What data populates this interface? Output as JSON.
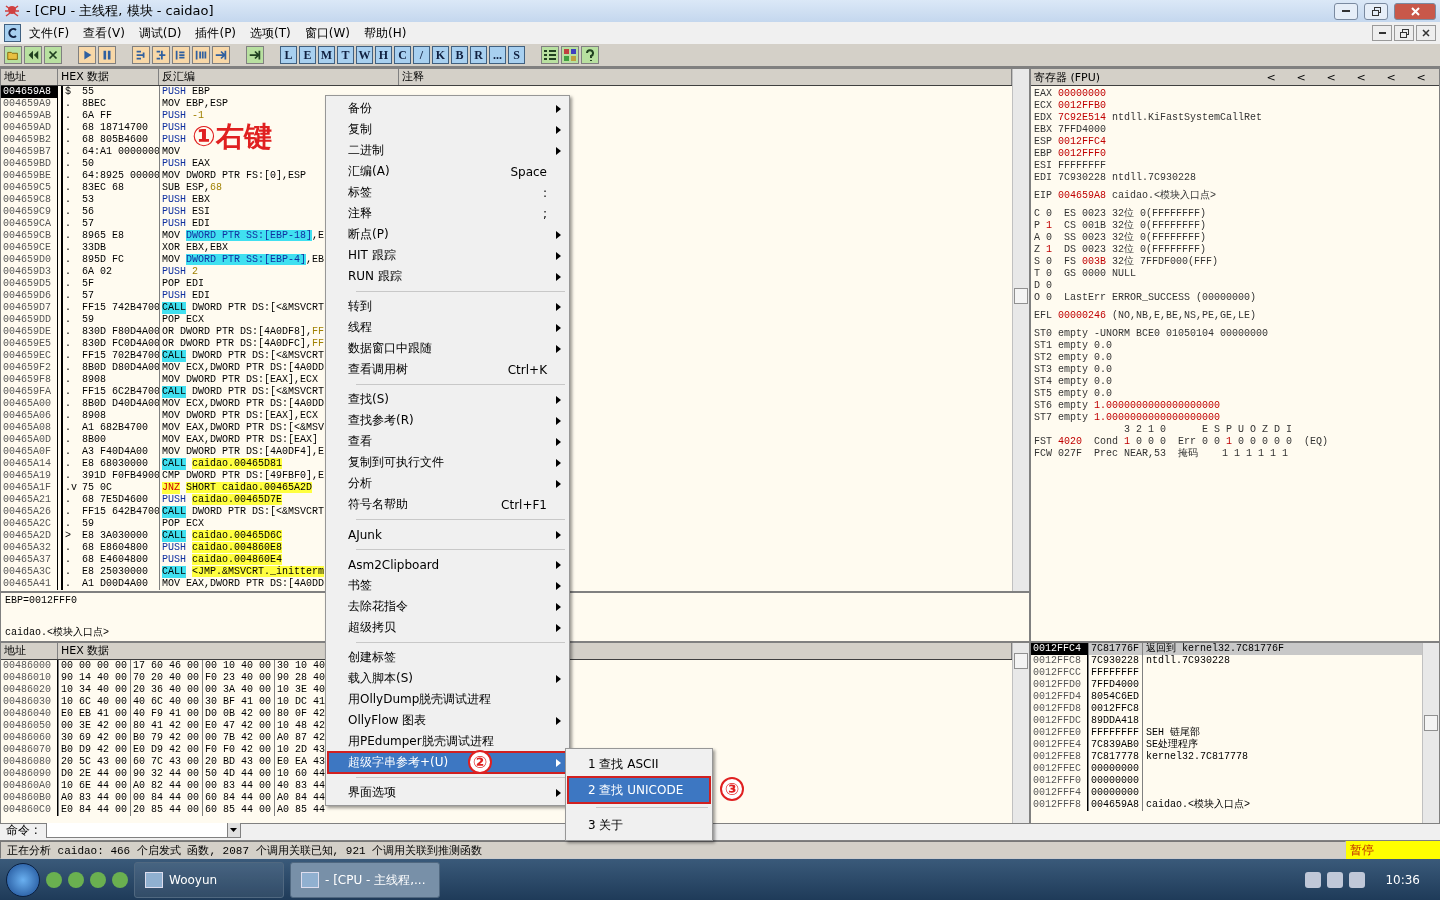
{
  "window": {
    "title": "- [CPU - 主线程, 模块 - caidao]"
  },
  "menu_bar": [
    "文件(F)",
    "查看(V)",
    "调试(D)",
    "插件(P)",
    "选项(T)",
    "窗口(W)",
    "帮助(H)"
  ],
  "toolbar": {
    "letters": [
      "L",
      "E",
      "M",
      "T",
      "W",
      "H",
      "C",
      "/",
      "K",
      "B",
      "R",
      "...",
      "S"
    ]
  },
  "disassembly": {
    "columns": [
      "地址",
      "HEX 数据",
      "反汇编",
      "注释"
    ],
    "rows": [
      {
        "address": "004659A8",
        "mark": "$",
        "hex": "55",
        "op": "PUSH",
        "kind": "push",
        "args": [
          {
            "text": "EBP",
            "kind": "plain"
          }
        ],
        "selected": true
      },
      {
        "address": "004659A9",
        "mark": ".",
        "hex": "8BEC",
        "op": "MOV",
        "kind": "plain",
        "args": [
          {
            "text": "EBP,ESP",
            "kind": "plain"
          }
        ],
        "selected": false
      },
      {
        "address": "004659AB",
        "mark": ".",
        "hex": "6A FF",
        "op": "PUSH",
        "kind": "push",
        "args": [
          {
            "text": "-1",
            "kind": "const"
          }
        ],
        "selected": false
      },
      {
        "address": "004659AD",
        "mark": ".",
        "hex": "68 18714700",
        "op": "PUSH",
        "kind": "push",
        "args": [],
        "selected": false
      },
      {
        "address": "004659B2",
        "mark": ".",
        "hex": "68 805B4600",
        "op": "PUSH",
        "kind": "push",
        "args": [],
        "selected": false
      },
      {
        "address": "004659B7",
        "mark": ".",
        "hex": "64:A1 0000000",
        "op": "MOV",
        "kind": "plain",
        "args": [],
        "selected": false
      },
      {
        "address": "004659BD",
        "mark": ".",
        "hex": "50",
        "op": "PUSH",
        "kind": "push",
        "args": [
          {
            "text": "EAX",
            "kind": "plain"
          }
        ],
        "selected": false
      },
      {
        "address": "004659BE",
        "mark": ".",
        "hex": "64:8925 00000",
        "op": "MOV",
        "kind": "plain",
        "args": [
          {
            "text": "DWORD PTR FS:[0],ESP",
            "kind": "plain"
          }
        ],
        "selected": false
      },
      {
        "address": "004659C5",
        "mark": ".",
        "hex": "83EC 68",
        "op": "SUB",
        "kind": "plain",
        "args": [
          {
            "text": "ESP,",
            "kind": "plain"
          },
          {
            "text": "68",
            "kind": "const"
          }
        ],
        "selected": false
      },
      {
        "address": "004659C8",
        "mark": ".",
        "hex": "53",
        "op": "PUSH",
        "kind": "push",
        "args": [
          {
            "text": "EBX",
            "kind": "plain"
          }
        ],
        "selected": false
      },
      {
        "address": "004659C9",
        "mark": ".",
        "hex": "56",
        "op": "PUSH",
        "kind": "push",
        "args": [
          {
            "text": "ESI",
            "kind": "plain"
          }
        ],
        "selected": false
      },
      {
        "address": "004659CA",
        "mark": ".",
        "hex": "57",
        "op": "PUSH",
        "kind": "push",
        "args": [
          {
            "text": "EDI",
            "kind": "plain"
          }
        ],
        "selected": false
      },
      {
        "address": "004659CB",
        "mark": ".",
        "hex": "8965 E8",
        "op": "MOV",
        "kind": "plain",
        "args": [
          {
            "text": "DWORD PTR SS:[EBP-18]",
            "kind": "stack"
          },
          {
            "text": ",E",
            "kind": "plain"
          }
        ],
        "selected": false
      },
      {
        "address": "004659CE",
        "mark": ".",
        "hex": "33DB",
        "op": "XOR",
        "kind": "plain",
        "args": [
          {
            "text": "EBX,EBX",
            "kind": "plain"
          }
        ],
        "selected": false
      },
      {
        "address": "004659D0",
        "mark": ".",
        "hex": "895D FC",
        "op": "MOV",
        "kind": "plain",
        "args": [
          {
            "text": "DWORD PTR SS:[EBP-4]",
            "kind": "stack"
          },
          {
            "text": ",EB",
            "kind": "plain"
          }
        ],
        "selected": false
      },
      {
        "address": "004659D3",
        "mark": ".",
        "hex": "6A 02",
        "op": "PUSH",
        "kind": "push",
        "args": [
          {
            "text": "2",
            "kind": "const"
          }
        ],
        "selected": false
      },
      {
        "address": "004659D5",
        "mark": ".",
        "hex": "5F",
        "op": "POP",
        "kind": "plain",
        "args": [
          {
            "text": "EDI",
            "kind": "plain"
          }
        ],
        "selected": false
      },
      {
        "address": "004659D6",
        "mark": ".",
        "hex": "57",
        "op": "PUSH",
        "kind": "push",
        "args": [
          {
            "text": "EDI",
            "kind": "plain"
          }
        ],
        "selected": false
      },
      {
        "address": "004659D7",
        "mark": ".",
        "hex": "FF15 742B4700",
        "op": "CALL",
        "kind": "call",
        "args": [
          {
            "text": "DWORD PTR DS:[<&MSVCRT",
            "kind": "plain"
          }
        ],
        "selected": false
      },
      {
        "address": "004659DD",
        "mark": ".",
        "hex": "59",
        "op": "POP",
        "kind": "plain",
        "args": [
          {
            "text": "ECX",
            "kind": "plain"
          }
        ],
        "selected": false
      },
      {
        "address": "004659DE",
        "mark": ".",
        "hex": "830D F80D4A00",
        "op": "OR",
        "kind": "plain",
        "args": [
          {
            "text": "DWORD PTR DS:[4A0DF8],",
            "kind": "plain"
          },
          {
            "text": "FF",
            "kind": "const"
          }
        ],
        "selected": false
      },
      {
        "address": "004659E5",
        "mark": ".",
        "hex": "830D FC0D4A00",
        "op": "OR",
        "kind": "plain",
        "args": [
          {
            "text": "DWORD PTR DS:[4A0DFC],",
            "kind": "plain"
          },
          {
            "text": "FF",
            "kind": "const"
          }
        ],
        "selected": false
      },
      {
        "address": "004659EC",
        "mark": ".",
        "hex": "FF15 702B4700",
        "op": "CALL",
        "kind": "call",
        "args": [
          {
            "text": "DWORD PTR DS:[<&MSVCRT",
            "kind": "plain"
          }
        ],
        "selected": false
      },
      {
        "address": "004659F2",
        "mark": ".",
        "hex": "8B0D D80D4A00",
        "op": "MOV",
        "kind": "plain",
        "args": [
          {
            "text": "ECX,DWORD PTR DS:[4A0DD",
            "kind": "plain"
          }
        ],
        "selected": false
      },
      {
        "address": "004659F8",
        "mark": ".",
        "hex": "8908",
        "op": "MOV",
        "kind": "plain",
        "args": [
          {
            "text": "DWORD PTR DS:[EAX],ECX",
            "kind": "plain"
          }
        ],
        "selected": false
      },
      {
        "address": "004659FA",
        "mark": ".",
        "hex": "FF15 6C2B4700",
        "op": "CALL",
        "kind": "call",
        "args": [
          {
            "text": "DWORD PTR DS:[<&MSVCRT",
            "kind": "plain"
          }
        ],
        "selected": false
      },
      {
        "address": "00465A00",
        "mark": ".",
        "hex": "8B0D D40D4A00",
        "op": "MOV",
        "kind": "plain",
        "args": [
          {
            "text": "ECX,DWORD PTR DS:[4A0DD",
            "kind": "plain"
          }
        ],
        "selected": false
      },
      {
        "address": "00465A06",
        "mark": ".",
        "hex": "8908",
        "op": "MOV",
        "kind": "plain",
        "args": [
          {
            "text": "DWORD PTR DS:[EAX],ECX",
            "kind": "plain"
          }
        ],
        "selected": false
      },
      {
        "address": "00465A08",
        "mark": ".",
        "hex": "A1 682B4700",
        "op": "MOV",
        "kind": "plain",
        "args": [
          {
            "text": "EAX,DWORD PTR DS:[<&MSV",
            "kind": "plain"
          }
        ],
        "selected": false
      },
      {
        "address": "00465A0D",
        "mark": ".",
        "hex": "8B00",
        "op": "MOV",
        "kind": "plain",
        "args": [
          {
            "text": "EAX,DWORD PTR DS:[EAX]",
            "kind": "plain"
          }
        ],
        "selected": false
      },
      {
        "address": "00465A0F",
        "mark": ".",
        "hex": "A3 F40D4A00",
        "op": "MOV",
        "kind": "plain",
        "args": [
          {
            "text": "DWORD PTR DS:[4A0DF4],E",
            "kind": "plain"
          }
        ],
        "selected": false
      },
      {
        "address": "00465A14",
        "mark": ".",
        "hex": "E8 68030000",
        "op": "CALL",
        "kind": "call",
        "args": [
          {
            "text": "caidao.00465D81",
            "kind": "symbol"
          }
        ],
        "selected": false
      },
      {
        "address": "00465A19",
        "mark": ".",
        "hex": "391D F0FB4900",
        "op": "CMP",
        "kind": "plain",
        "args": [
          {
            "text": "DWORD PTR DS:[49FBF0],E",
            "kind": "plain"
          }
        ],
        "selected": false
      },
      {
        "address": "00465A1F",
        "mark": ".v",
        "hex": "75 0C",
        "op": "JNZ",
        "kind": "jump",
        "args": [
          {
            "text": "SHORT caidao.00465A2D",
            "kind": "symbol"
          }
        ],
        "selected": false
      },
      {
        "address": "00465A21",
        "mark": ".",
        "hex": "68 7E5D4600",
        "op": "PUSH",
        "kind": "push",
        "args": [
          {
            "text": "caidao.00465D7E",
            "kind": "symbol"
          }
        ],
        "selected": false
      },
      {
        "address": "00465A26",
        "mark": ".",
        "hex": "FF15 642B4700",
        "op": "CALL",
        "kind": "call",
        "args": [
          {
            "text": "DWORD PTR DS:[<&MSVCRT",
            "kind": "plain"
          }
        ],
        "selected": false
      },
      {
        "address": "00465A2C",
        "mark": ".",
        "hex": "59",
        "op": "POP",
        "kind": "plain",
        "args": [
          {
            "text": "ECX",
            "kind": "plain"
          }
        ],
        "selected": false
      },
      {
        "address": "00465A2D",
        "mark": ">",
        "hex": "E8 3A030000",
        "op": "CALL",
        "kind": "call",
        "args": [
          {
            "text": "caidao.00465D6C",
            "kind": "symbol"
          }
        ],
        "selected": false
      },
      {
        "address": "00465A32",
        "mark": ".",
        "hex": "68 E8604800",
        "op": "PUSH",
        "kind": "push",
        "args": [
          {
            "text": "caidao.004860E8",
            "kind": "symbol"
          }
        ],
        "selected": false
      },
      {
        "address": "00465A37",
        "mark": ".",
        "hex": "68 E4604800",
        "op": "PUSH",
        "kind": "push",
        "args": [
          {
            "text": "caidao.004860E4",
            "kind": "symbol"
          }
        ],
        "selected": false
      },
      {
        "address": "00465A3C",
        "mark": ".",
        "hex": "E8 25030000",
        "op": "CALL",
        "kind": "call",
        "args": [
          {
            "text": "<JMP.&MSVCRT._initterm",
            "kind": "symbol"
          }
        ],
        "selected": false
      },
      {
        "address": "00465A41",
        "mark": ".",
        "hex": "A1 D00D4A00",
        "op": "MOV",
        "kind": "plain",
        "args": [
          {
            "text": "EAX,DWORD PTR DS:[4A0DD",
            "kind": "plain"
          }
        ],
        "selected": false
      }
    ]
  },
  "annotation": "①右键",
  "info_pane": {
    "line": "EBP=0012FFF0",
    "location": "caidao.<模块入口点>"
  },
  "dump": {
    "columns": [
      "地址",
      "HEX 数据"
    ],
    "rows": [
      {
        "address": "00486000",
        "groups": [
          "00 00 00 00",
          "17 60 46 00",
          "00 10 40 00",
          "30 10 40"
        ]
      },
      {
        "address": "00486010",
        "groups": [
          "90 14 40 00",
          "70 20 40 00",
          "F0 23 40 00",
          "90 28 40"
        ]
      },
      {
        "address": "00486020",
        "groups": [
          "10 34 40 00",
          "20 36 40 00",
          "00 3A 40 00",
          "10 3E 40"
        ]
      },
      {
        "address": "00486030",
        "groups": [
          "10 6C 40 00",
          "40 6C 40 00",
          "30 BF 41 00",
          "10 DC 41"
        ]
      },
      {
        "address": "00486040",
        "groups": [
          "E0 EB 41 00",
          "40 F9 41 00",
          "D0 0B 42 00",
          "80 0F 42"
        ]
      },
      {
        "address": "00486050",
        "groups": [
          "00 3E 42 00",
          "80 41 42 00",
          "E0 47 42 00",
          "10 48 42"
        ]
      },
      {
        "address": "00486060",
        "groups": [
          "30 69 42 00",
          "B0 79 42 00",
          "00 7B 42 00",
          "A0 87 42"
        ]
      },
      {
        "address": "00486070",
        "groups": [
          "B0 D9 42 00",
          "E0 D9 42 00",
          "F0 F0 42 00",
          "10 2D 43"
        ]
      },
      {
        "address": "00486080",
        "groups": [
          "20 5C 43 00",
          "60 7C 43 00",
          "20 BD 43 00",
          "E0 EA 43"
        ]
      },
      {
        "address": "00486090",
        "groups": [
          "D0 2E 44 00",
          "90 32 44 00",
          "50 4D 44 00",
          "10 60 44"
        ]
      },
      {
        "address": "004860A0",
        "groups": [
          "10 6E 44 00",
          "A0 82 44 00",
          "00 83 44 00",
          "40 83 44"
        ]
      },
      {
        "address": "004860B0",
        "groups": [
          "A0 83 44 00",
          "00 84 44 00",
          "60 84 44 00",
          "A0 84 44"
        ]
      },
      {
        "address": "004860C0",
        "groups": [
          "E0 84 44 00",
          "20 85 44 00",
          "60 85 44 00",
          "A0 85 44"
        ]
      }
    ]
  },
  "registers": {
    "title": "寄存器 (FPU)",
    "nav_arrows": [
      "<",
      "<",
      "<",
      "<",
      "<",
      "<"
    ],
    "groups": [
      [
        [
          {
            "text": "EAX",
            "kind": "name"
          },
          {
            "text": "00000000",
            "kind": "changed"
          }
        ],
        [
          {
            "text": "ECX",
            "kind": "name"
          },
          {
            "text": "0012FFB0",
            "kind": "changed"
          }
        ],
        [
          {
            "text": "EDX",
            "kind": "name"
          },
          {
            "text": "7C92E514",
            "kind": "changed"
          },
          {
            "text": "ntdll.KiFastSystemCallRet",
            "kind": "plain"
          }
        ],
        [
          {
            "text": "EBX",
            "kind": "name"
          },
          {
            "text": "7FFD4000",
            "kind": "plain"
          }
        ],
        [
          {
            "text": "ESP",
            "kind": "name"
          },
          {
            "text": "0012FFC4",
            "kind": "changed"
          }
        ],
        [
          {
            "text": "EBP",
            "kind": "name"
          },
          {
            "text": "0012FFF0",
            "kind": "changed"
          }
        ],
        [
          {
            "text": "ESI",
            "kind": "name"
          },
          {
            "text": "FFFFFFFF",
            "kind": "plain"
          }
        ],
        [
          {
            "text": "EDI",
            "kind": "name"
          },
          {
            "text": "7C930228",
            "kind": "plain"
          },
          {
            "text": "ntdll.7C930228",
            "kind": "plain"
          }
        ]
      ],
      [
        [
          {
            "text": "EIP",
            "kind": "name"
          },
          {
            "text": "004659A8",
            "kind": "changed"
          },
          {
            "text": "caidao.<模块入口点>",
            "kind": "plain"
          }
        ]
      ],
      [
        [
          {
            "text": "C",
            "kind": "name"
          },
          {
            "text": "0",
            "kind": "plain"
          },
          {
            "text": " ES 0023 32位 0(FFFFFFFF)",
            "kind": "plain"
          }
        ],
        [
          {
            "text": "P",
            "kind": "name"
          },
          {
            "text": "1",
            "kind": "changed"
          },
          {
            "text": " CS 001B 32位 0(FFFFFFFF)",
            "kind": "plain"
          }
        ],
        [
          {
            "text": "A",
            "kind": "name"
          },
          {
            "text": "0",
            "kind": "plain"
          },
          {
            "text": " SS 0023 32位 0(FFFFFFFF)",
            "kind": "plain"
          }
        ],
        [
          {
            "text": "Z",
            "kind": "name"
          },
          {
            "text": "1",
            "kind": "changed"
          },
          {
            "text": " DS 0023 32位 0(FFFFFFFF)",
            "kind": "plain"
          }
        ],
        [
          {
            "text": "S",
            "kind": "name"
          },
          {
            "text": "0",
            "kind": "plain"
          },
          {
            "text": " FS",
            "kind": "plain"
          },
          {
            "text": "003B",
            "kind": "changed"
          },
          {
            "text": "32位 7FFDF000(FFF)",
            "kind": "plain"
          }
        ],
        [
          {
            "text": "T",
            "kind": "name"
          },
          {
            "text": "0",
            "kind": "plain"
          },
          {
            "text": " GS 0000 NULL",
            "kind": "plain"
          }
        ],
        [
          {
            "text": "D",
            "kind": "name"
          },
          {
            "text": "0",
            "kind": "plain"
          }
        ],
        [
          {
            "text": "O",
            "kind": "name"
          },
          {
            "text": "0",
            "kind": "plain"
          },
          {
            "text": " LastErr ERROR_SUCCESS (00000000)",
            "kind": "plain"
          }
        ]
      ],
      [
        [
          {
            "text": "EFL",
            "kind": "name"
          },
          {
            "text": "00000246",
            "kind": "changed"
          },
          {
            "text": "(NO,NB,E,BE,NS,PE,GE,LE)",
            "kind": "plain"
          }
        ]
      ],
      [
        [
          {
            "text": "ST0",
            "kind": "name"
          },
          {
            "text": "empty -UNORM BCE0 01050104 00000000",
            "kind": "plain"
          }
        ],
        [
          {
            "text": "ST1",
            "kind": "name"
          },
          {
            "text": "empty 0.0",
            "kind": "plain"
          }
        ],
        [
          {
            "text": "ST2",
            "kind": "name"
          },
          {
            "text": "empty 0.0",
            "kind": "plain"
          }
        ],
        [
          {
            "text": "ST3",
            "kind": "name"
          },
          {
            "text": "empty 0.0",
            "kind": "plain"
          }
        ],
        [
          {
            "text": "ST4",
            "kind": "name"
          },
          {
            "text": "empty 0.0",
            "kind": "plain"
          }
        ],
        [
          {
            "text": "ST5",
            "kind": "name"
          },
          {
            "text": "empty 0.0",
            "kind": "plain"
          }
        ],
        [
          {
            "text": "ST6",
            "kind": "name"
          },
          {
            "text": "empty",
            "kind": "plain"
          },
          {
            "text": "1.0000000000000000000",
            "kind": "changed"
          }
        ],
        [
          {
            "text": "ST7",
            "kind": "name"
          },
          {
            "text": "empty",
            "kind": "plain"
          },
          {
            "text": "1.0000000000000000000",
            "kind": "changed"
          }
        ],
        [
          {
            "text": "               3 2 1 0      E S P U O Z D I",
            "kind": "plain"
          }
        ],
        [
          {
            "text": "FST",
            "kind": "name"
          },
          {
            "text": "4020",
            "kind": "changed"
          },
          {
            "text": " Cond",
            "kind": "plain"
          },
          {
            "text": "1",
            "kind": "changed"
          },
          {
            "text": "0 0 0  Err 0 0",
            "kind": "plain"
          },
          {
            "text": "1",
            "kind": "changed"
          },
          {
            "text": "0 0 0 0 0  (EQ)",
            "kind": "plain"
          }
        ],
        [
          {
            "text": "FCW",
            "kind": "name"
          },
          {
            "text": "027F  Prec NEAR,53  掩码    1 1 1 1 1 1",
            "kind": "plain"
          }
        ]
      ]
    ]
  },
  "stack": {
    "rows": [
      {
        "address": "0012FFC4",
        "value": "7C81776F",
        "comment": "返回到 kernel32.7C81776F",
        "selected": true
      },
      {
        "address": "0012FFC8",
        "value": "7C930228",
        "comment": "ntdll.7C930228",
        "selected": false
      },
      {
        "address": "0012FFCC",
        "value": "FFFFFFFF",
        "selected": false
      },
      {
        "address": "0012FFD0",
        "value": "7FFD4000",
        "selected": false
      },
      {
        "address": "0012FFD4",
        "value": "8054C6ED",
        "selected": false
      },
      {
        "address": "0012FFD8",
        "value": "0012FFC8",
        "selected": false
      },
      {
        "address": "0012FFDC",
        "value": "89DDA418",
        "selected": false
      },
      {
        "address": "0012FFE0",
        "value": "FFFFFFFF",
        "comment": "SEH 链尾部",
        "selected": false
      },
      {
        "address": "0012FFE4",
        "value": "7C839AB0",
        "comment": "SE处理程序",
        "selected": false
      },
      {
        "address": "0012FFE8",
        "value": "7C817778",
        "comment": "kernel32.7C817778",
        "selected": false
      },
      {
        "address": "0012FFEC",
        "value": "00000000",
        "selected": false
      },
      {
        "address": "0012FFF0",
        "value": "00000000",
        "selected": false
      },
      {
        "address": "0012FFF4",
        "value": "00000000",
        "selected": false
      },
      {
        "address": "0012FFF8",
        "value": "004659A8",
        "comment": "caidao.<模块入口点>",
        "selected": false
      }
    ]
  },
  "command_bar": {
    "label": "命令 :"
  },
  "status_bar": {
    "message": "正在分析 caidao: 466 个启发式 函数, 2087 个调用关联已知, 921 个调用关联到推测函数",
    "state": "暂停"
  },
  "context_menu": {
    "items": [
      {
        "kind": "item",
        "label": "备份",
        "submenu": true,
        "selected": false
      },
      {
        "kind": "item",
        "label": "复制",
        "submenu": true,
        "selected": false
      },
      {
        "kind": "item",
        "label": "二进制",
        "submenu": true,
        "selected": false
      },
      {
        "kind": "item",
        "label": "汇编(A)",
        "shortcut": "Space",
        "submenu": false,
        "selected": false
      },
      {
        "kind": "item",
        "label": "标签",
        "shortcut": ":",
        "submenu": false,
        "selected": false
      },
      {
        "kind": "item",
        "label": "注释",
        "shortcut": ";",
        "submenu": false,
        "selected": false
      },
      {
        "kind": "item",
        "label": "断点(P)",
        "submenu": true,
        "selected": false
      },
      {
        "kind": "item",
        "label": "HIT 跟踪",
        "submenu": true,
        "selected": false
      },
      {
        "kind": "item",
        "label": "RUN 跟踪",
        "submenu": true,
        "selected": false
      },
      {
        "kind": "separator"
      },
      {
        "kind": "item",
        "label": "转到",
        "submenu": true,
        "selected": false
      },
      {
        "kind": "item",
        "label": "线程",
        "submenu": true,
        "selected": false
      },
      {
        "kind": "item",
        "label": "数据窗口中跟随",
        "submenu": true,
        "selected": false
      },
      {
        "kind": "item",
        "label": "查看调用树",
        "shortcut": "Ctrl+K",
        "submenu": false,
        "selected": false
      },
      {
        "kind": "separator"
      },
      {
        "kind": "item",
        "label": "查找(S)",
        "submenu": true,
        "selected": false
      },
      {
        "kind": "item",
        "label": "查找参考(R)",
        "submenu": true,
        "selected": false
      },
      {
        "kind": "item",
        "label": "查看",
        "submenu": true,
        "selected": false
      },
      {
        "kind": "item",
        "label": "复制到可执行文件",
        "submenu": true,
        "selected": false
      },
      {
        "kind": "item",
        "label": "分析",
        "submenu": true,
        "selected": false
      },
      {
        "kind": "item",
        "label": "符号名帮助",
        "shortcut": "Ctrl+F1",
        "submenu": false,
        "selected": false
      },
      {
        "kind": "separator"
      },
      {
        "kind": "item",
        "label": "AJunk",
        "submenu": true,
        "selected": false
      },
      {
        "kind": "separator"
      },
      {
        "kind": "item",
        "label": "Asm2Clipboard",
        "submenu": true,
        "selected": false
      },
      {
        "kind": "item",
        "label": "书签",
        "submenu": true,
        "selected": false
      },
      {
        "kind": "item",
        "label": "去除花指令",
        "submenu": true,
        "selected": false
      },
      {
        "kind": "item",
        "label": "超级拷贝",
        "submenu": true,
        "selected": false
      },
      {
        "kind": "separator"
      },
      {
        "kind": "item",
        "label": "创建标签",
        "submenu": false,
        "selected": false
      },
      {
        "kind": "item",
        "label": "载入脚本(S)",
        "submenu": true,
        "selected": false
      },
      {
        "kind": "item",
        "label": "用OllyDump脱壳调试进程",
        "submenu": false,
        "selected": false
      },
      {
        "kind": "item",
        "label": "OllyFlow 图表",
        "submenu": true,
        "selected": false
      },
      {
        "kind": "item",
        "label": "用PEdumper脱壳调试进程",
        "submenu": false,
        "selected": false
      },
      {
        "kind": "item",
        "label": "超级字串参考+(U)",
        "submenu": true,
        "selected": true,
        "callout": "②"
      },
      {
        "kind": "separator"
      },
      {
        "kind": "item",
        "label": "界面选项",
        "submenu": true,
        "selected": false
      }
    ]
  },
  "submenu": {
    "items": [
      {
        "kind": "item",
        "label": "1 查找 ASCII",
        "selected": false
      },
      {
        "kind": "item",
        "label": "2 查找 UNICODE",
        "selected": true,
        "callout": "③"
      },
      {
        "kind": "separator"
      },
      {
        "kind": "item",
        "label": "3 关于",
        "selected": false
      }
    ]
  },
  "taskbar": {
    "tasks": [
      {
        "label": "Wooyun",
        "selected": false
      },
      {
        "label": "- [CPU - 主线程,...",
        "selected": true
      }
    ],
    "clock": "10:36"
  }
}
